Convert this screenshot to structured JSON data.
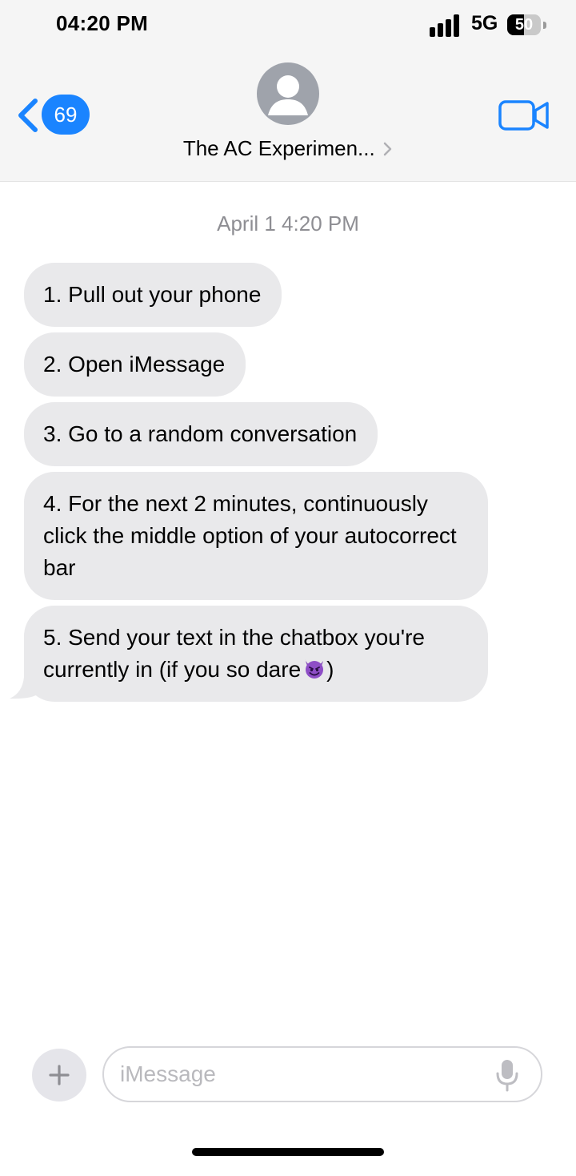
{
  "status_bar": {
    "time": "04:20 PM",
    "network": "5G",
    "battery_text": "50",
    "battery_level_percent": 50,
    "icons": [
      "signal-bars-icon",
      "battery-icon"
    ]
  },
  "header": {
    "back_badge_count": "69",
    "contact_name": "The AC Experimen...",
    "icons": [
      "back-chevron-icon",
      "avatar-person-icon",
      "contact-chevron-icon",
      "video-call-icon"
    ],
    "accent_color": "#1a84ff"
  },
  "conversation": {
    "timestamp": "April 1 4:20 PM",
    "messages": [
      {
        "text": "1. Pull out your phone"
      },
      {
        "text": "2. Open iMessage"
      },
      {
        "text": "3. Go to a random conversation"
      },
      {
        "text": "4. For the next 2 minutes, continuously click the middle option of your autocorrect bar"
      },
      {
        "text": "5. Send your text in the chatbox you're currently in (if you so dare",
        "emoji": "smiling-face-with-horns-icon",
        "suffix": ")"
      }
    ],
    "bubble_color": "#e9e9eb"
  },
  "composer": {
    "placeholder": "iMessage",
    "icons": [
      "plus-icon",
      "microphone-icon"
    ]
  }
}
